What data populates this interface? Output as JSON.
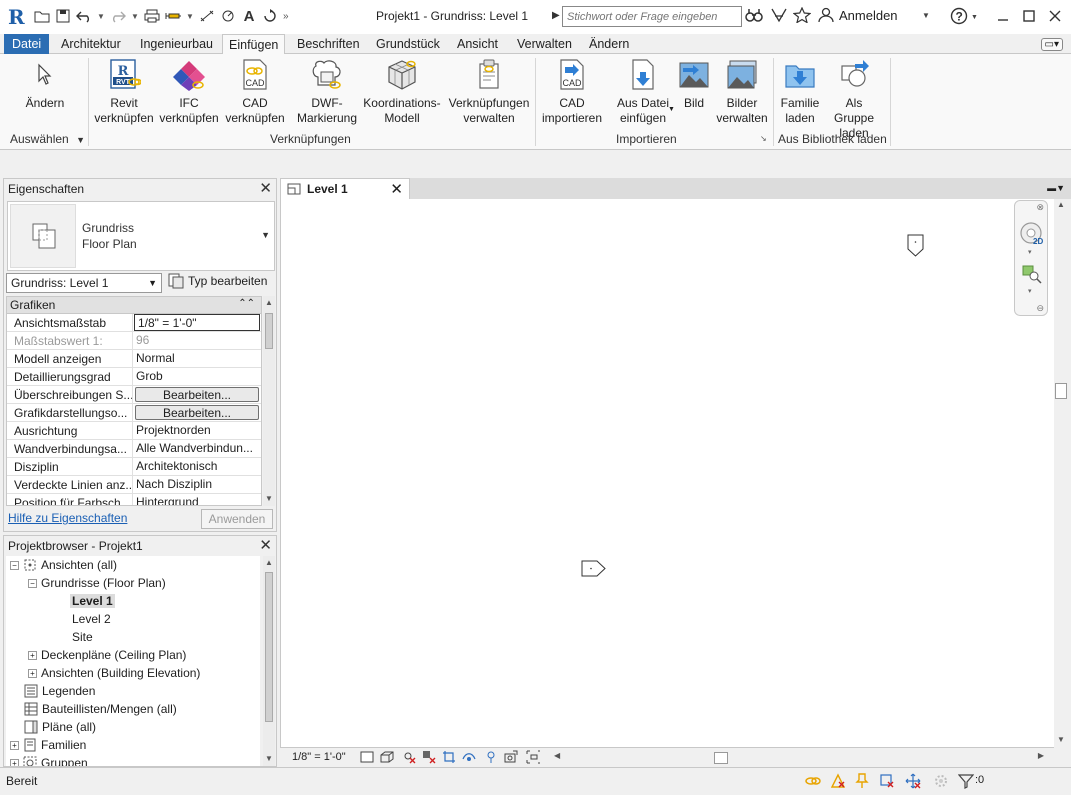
{
  "titlebar": {
    "logo": "R",
    "document_title": "Projekt1 - Grundriss: Level 1",
    "search_placeholder": "Stichwort oder Frage eingeben",
    "login_label": "Anmelden",
    "help_label": "?"
  },
  "tabs": [
    "Datei",
    "Architektur",
    "Ingenieurbau",
    "Einfügen",
    "Beschriften",
    "Grundstück",
    "Ansicht",
    "Verwalten",
    "Ändern"
  ],
  "ribbon": {
    "modify": {
      "line1": "Ändern",
      "line2": ""
    },
    "revit_link": {
      "line1": "Revit",
      "line2": "verknüpfen",
      "icon_text": "RVT"
    },
    "ifc_link": {
      "line1": "IFC",
      "line2": "verknüpfen"
    },
    "cad_link": {
      "line1": "CAD",
      "line2": "verknüpfen",
      "icon_text": "CAD"
    },
    "dwf_markup": {
      "line1": "DWF-",
      "line2": "Markierung"
    },
    "coord_model": {
      "line1": "Koordinations-",
      "line2": "Modell"
    },
    "manage_links": {
      "line1": "Verknüpfungen",
      "line2": "verwalten"
    },
    "cad_import": {
      "line1": "CAD",
      "line2": "importieren",
      "icon_text": "CAD"
    },
    "insert_from_file": {
      "line1": "Aus Datei",
      "line2": "einfügen"
    },
    "image": {
      "line1": "Bild",
      "line2": ""
    },
    "manage_images": {
      "line1": "Bilder",
      "line2": "verwalten"
    },
    "load_family": {
      "line1": "Familie",
      "line2": "laden"
    },
    "load_as_group": {
      "line1": "Als Gruppe",
      "line2": "laden"
    },
    "groups": {
      "select": "Auswählen",
      "link": "Verknüpfungen",
      "import": "Importieren",
      "library": "Aus Bibliothek laden"
    }
  },
  "properties": {
    "title": "Eigenschaften",
    "type_line1": "Grundriss",
    "type_line2": "Floor Plan",
    "instance_selector": "Grundriss: Level 1",
    "edit_type": "Typ bearbeiten",
    "category": "Grafiken",
    "rows": [
      {
        "name": "Ansichtsmaßstab",
        "value": "1/8\" = 1'-0\""
      },
      {
        "name": "Maßstabswert 1:",
        "value": "96"
      },
      {
        "name": "Modell anzeigen",
        "value": "Normal"
      },
      {
        "name": "Detaillierungsgrad",
        "value": "Grob"
      },
      {
        "name": "Überschreibungen S...",
        "value": "Bearbeiten..."
      },
      {
        "name": "Grafikdarstellungso...",
        "value": "Bearbeiten..."
      },
      {
        "name": "Ausrichtung",
        "value": "Projektnorden"
      },
      {
        "name": "Wandverbindungsa...",
        "value": "Alle Wandverbindun..."
      },
      {
        "name": "Disziplin",
        "value": "Architektonisch"
      },
      {
        "name": "Verdeckte Linien anz...",
        "value": "Nach Disziplin"
      },
      {
        "name": "Position für Farbsch...",
        "value": "Hintergrund"
      }
    ],
    "help_link": "Hilfe zu Eigenschaften",
    "apply": "Anwenden"
  },
  "browser": {
    "title": "Projektbrowser - Projekt1",
    "nodes": [
      {
        "label": "Ansichten (all)"
      },
      {
        "label": "Grundrisse (Floor Plan)"
      },
      {
        "label": "Level 1"
      },
      {
        "label": "Level 2"
      },
      {
        "label": "Site"
      },
      {
        "label": "Deckenpläne (Ceiling Plan)"
      },
      {
        "label": "Ansichten (Building Elevation)"
      },
      {
        "label": "Legenden"
      },
      {
        "label": "Bauteillisten/Mengen (all)"
      },
      {
        "label": "Pläne (all)"
      },
      {
        "label": "Familien"
      },
      {
        "label": "Gruppen"
      }
    ]
  },
  "view": {
    "tab_label": "Level 1",
    "scale": "1/8\" = 1'-0\""
  },
  "statusbar": {
    "text": "Bereit",
    "filter_count": ":0"
  }
}
